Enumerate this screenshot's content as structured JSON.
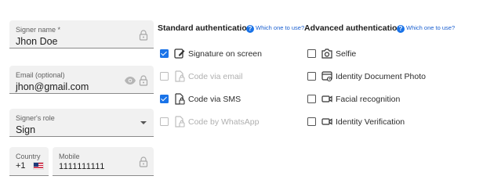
{
  "form": {
    "signer_name": {
      "label": "Signer name *",
      "value": "Jhon Doe"
    },
    "email": {
      "label": "Email (optional)",
      "value": "jhon@gmail.com"
    },
    "role": {
      "label": "Signer's role",
      "value": "Sign"
    },
    "country": {
      "label": "Country",
      "value": "+1",
      "flag": "us-flag"
    },
    "mobile": {
      "label": "Mobile",
      "value": "1111111111"
    }
  },
  "standard_auth": {
    "title": "Standard authentication",
    "help_link": "Which one to use?",
    "options": [
      {
        "label": "Signature on screen",
        "checked": true,
        "disabled": false,
        "icon": "signature-pen-icon"
      },
      {
        "label": "Code via email",
        "checked": false,
        "disabled": true,
        "icon": "document-lock-icon"
      },
      {
        "label": "Code via SMS",
        "checked": true,
        "disabled": false,
        "icon": "document-lock-icon"
      },
      {
        "label": "Code by WhatsApp",
        "checked": false,
        "disabled": true,
        "icon": "document-lock-icon"
      }
    ]
  },
  "advanced_auth": {
    "title": "Advanced authentication",
    "help_link": "Which one to use?",
    "options": [
      {
        "label": "Selfie",
        "checked": false,
        "disabled": false,
        "icon": "camera-icon"
      },
      {
        "label": "Identity Document Photo",
        "checked": false,
        "disabled": false,
        "icon": "id-card-icon"
      },
      {
        "label": "Facial recognition",
        "checked": false,
        "disabled": false,
        "icon": "video-camera-icon"
      },
      {
        "label": "Identity Verification",
        "checked": false,
        "disabled": false,
        "icon": "video-camera-icon"
      }
    ]
  },
  "colors": {
    "accent": "#1a73e8",
    "field_bg": "#f1f1f1",
    "disabled_text": "#b0b0b0"
  }
}
